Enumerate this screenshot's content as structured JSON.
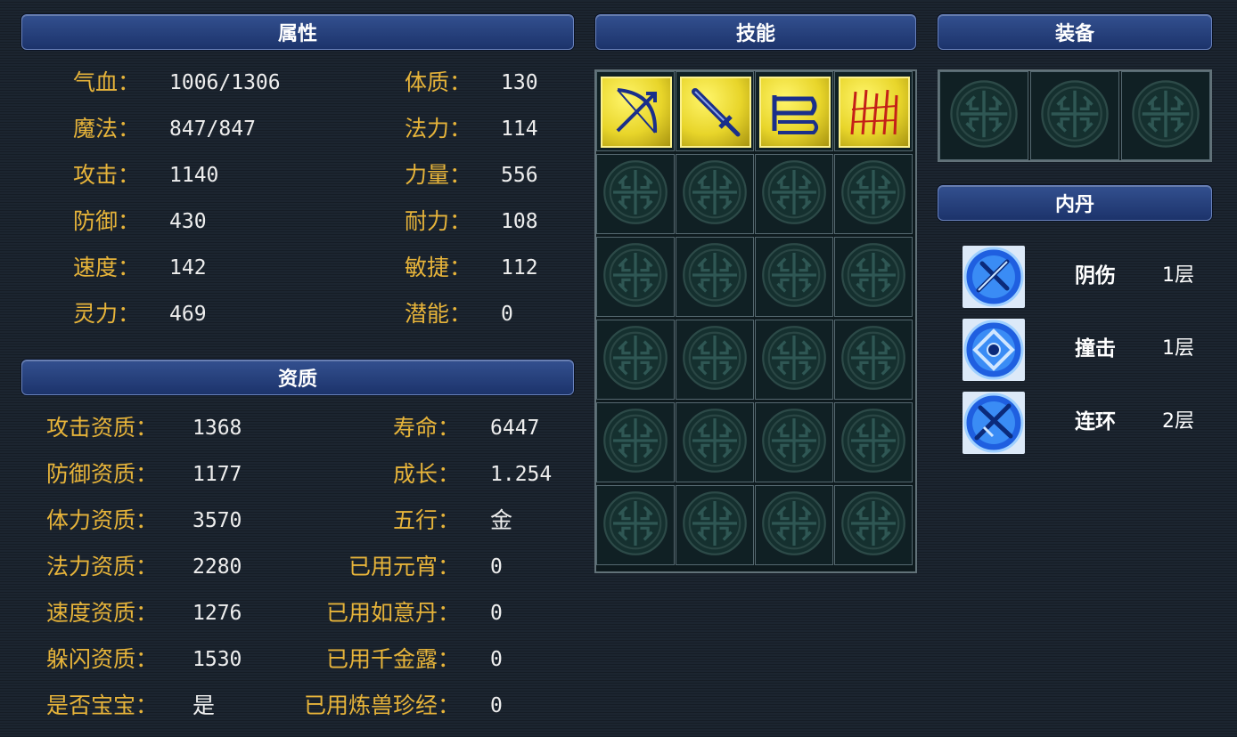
{
  "headers": {
    "attributes": "属性",
    "aptitude": "资质",
    "skills": "技能",
    "equipment": "装备",
    "inner_dan": "内丹"
  },
  "attributes": {
    "left": [
      {
        "label": "气血：",
        "value": "1006/1306"
      },
      {
        "label": "魔法：",
        "value": "847/847"
      },
      {
        "label": "攻击：",
        "value": "1140"
      },
      {
        "label": "防御：",
        "value": "430"
      },
      {
        "label": "速度：",
        "value": "142"
      },
      {
        "label": "灵力：",
        "value": "469"
      }
    ],
    "right": [
      {
        "label": "体质：",
        "value": "130"
      },
      {
        "label": "法力：",
        "value": "114"
      },
      {
        "label": "力量：",
        "value": "556"
      },
      {
        "label": "耐力：",
        "value": "108"
      },
      {
        "label": "敏捷：",
        "value": "112"
      },
      {
        "label": "潜能：",
        "value": "0"
      }
    ]
  },
  "aptitude": {
    "left": [
      {
        "label": "攻击资质：",
        "value": "1368"
      },
      {
        "label": "防御资质：",
        "value": "1177"
      },
      {
        "label": "体力资质：",
        "value": "3570"
      },
      {
        "label": "法力资质：",
        "value": "2280"
      },
      {
        "label": "速度资质：",
        "value": "1276"
      },
      {
        "label": "躲闪资质：",
        "value": "1530"
      },
      {
        "label": "是否宝宝：",
        "value": "是"
      }
    ],
    "right": [
      {
        "label": "寿命：",
        "value": "6447"
      },
      {
        "label": "成长：",
        "value": "1.254"
      },
      {
        "label": "五行：",
        "value": "金"
      },
      {
        "label": "已用元宵：",
        "value": "0"
      },
      {
        "label": "已用如意丹：",
        "value": "0"
      },
      {
        "label": "已用千金露：",
        "value": "0"
      },
      {
        "label": "已用炼兽珍经：",
        "value": "0"
      }
    ]
  },
  "skills": {
    "filled": [
      "bow-arrow-skill-icon",
      "sword-skill-icon",
      "banner-skill-icon",
      "flame-skill-icon"
    ],
    "colors": {
      "skill_bg": "#e8d52a",
      "skill_glyph": "#1a2f8a",
      "flame": "#c42018"
    }
  },
  "inner_dan": [
    {
      "icon": "crossed-swords-dan-icon",
      "name": "阴伤",
      "level": "1层"
    },
    {
      "icon": "shield-core-dan-icon",
      "name": "撞击",
      "level": "1层"
    },
    {
      "icon": "combo-swords-dan-icon",
      "name": "连环",
      "level": "2层"
    }
  ],
  "theme": {
    "label_color": "#e7b43a",
    "value_color": "#eeeeee",
    "header_color": "#2a4584"
  }
}
